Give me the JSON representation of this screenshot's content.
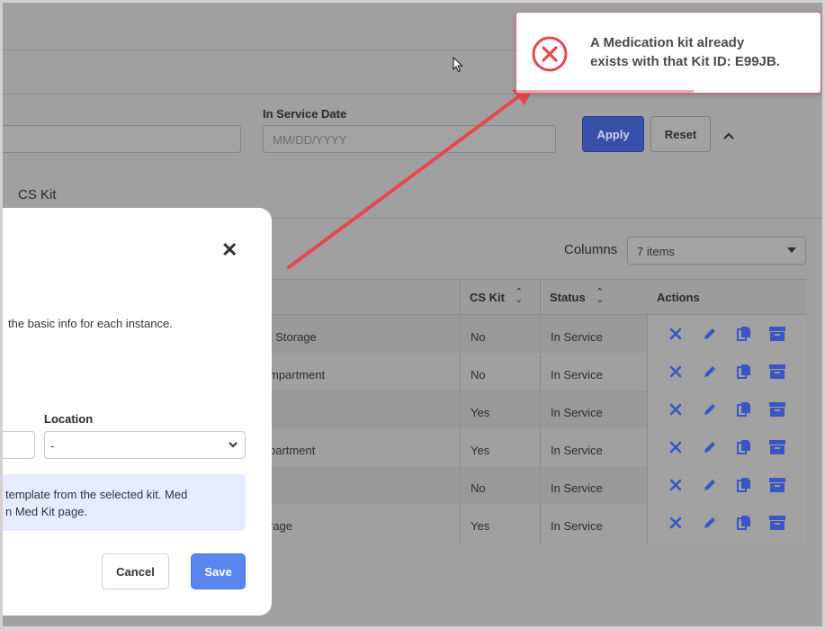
{
  "filters": {
    "in_service_date_label": "In Service Date",
    "in_service_date_placeholder": "MM/DD/YYYY",
    "apply_label": "Apply",
    "reset_label": "Reset"
  },
  "tabs": {
    "cs_kit": "CS Kit"
  },
  "columns": {
    "label": "Columns",
    "value": "7 items"
  },
  "table": {
    "headers": {
      "cs_kit": "CS Kit",
      "status": "Status",
      "actions": "Actions"
    },
    "rows": [
      {
        "location": "t Storage",
        "cs_kit": "No",
        "status": "In Service"
      },
      {
        "location": "mpartment",
        "cs_kit": "No",
        "status": "In Service"
      },
      {
        "location": "",
        "cs_kit": "Yes",
        "status": "In Service"
      },
      {
        "location": "partment",
        "cs_kit": "Yes",
        "status": "In Service"
      },
      {
        "location": "",
        "cs_kit": "No",
        "status": "In Service"
      },
      {
        "location": "rage",
        "cs_kit": "Yes",
        "status": "In Service"
      }
    ],
    "action_icons": [
      "close-icon",
      "pencil-icon",
      "copy-icon",
      "archive-icon"
    ]
  },
  "modal": {
    "close_glyph": "✕",
    "description": "the basic info for each instance.",
    "location_label": "Location",
    "location_value": "-",
    "info_line1": "template from the selected kit. Med",
    "info_line2": "n Med Kit page.",
    "cancel_label": "Cancel",
    "save_label": "Save"
  },
  "toast": {
    "line1": "A Medication kit already",
    "line2": "exists with that Kit ID: E99JB.",
    "progress": 0.58
  },
  "colors": {
    "primary": "#5b86f0",
    "error": "#e46c72",
    "action_icon": "#3a55c4"
  }
}
